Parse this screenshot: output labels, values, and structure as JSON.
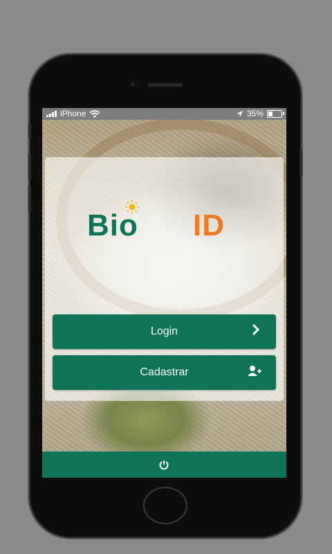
{
  "status_bar": {
    "carrier": "iPhone",
    "battery": "35%",
    "battery_level": 0.35
  },
  "logo": {
    "bio": "Bio",
    "id": "ID"
  },
  "buttons": {
    "login_label": "Login",
    "register_label": "Cadastrar"
  },
  "icons": {
    "login": "chevron-right-icon",
    "register": "add-user-icon",
    "power": "power-icon"
  },
  "colors": {
    "primary": "#0f7358",
    "accent": "#f0781e"
  }
}
